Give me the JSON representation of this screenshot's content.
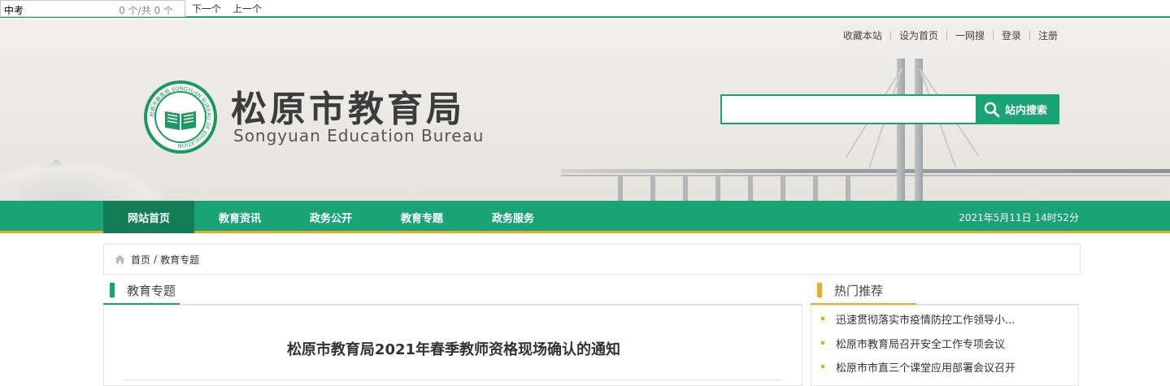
{
  "findbar": {
    "query": "中考",
    "count": "0 个/共 0 个",
    "next": "下一个",
    "prev": "上一个"
  },
  "header": {
    "toplinks": [
      "收藏本站",
      "设为首页",
      "一网搜",
      "登录",
      "注册"
    ],
    "title": "松原市教育局",
    "subtitle": "Songyuan Education Bureau",
    "logo_ring_text": "松原市教育局 SONGYUAN BUREAU OF EDUCATION",
    "search_value": "",
    "search_button": "站内搜索"
  },
  "nav": {
    "items": [
      "网站首页",
      "教育资讯",
      "政务公开",
      "教育专题",
      "政务服务"
    ],
    "active": 0,
    "datetime": "2021年5月11日 14时52分"
  },
  "breadcrumb": {
    "home": "首页",
    "separator": "/",
    "current": "教育专题"
  },
  "main": {
    "section_title": "教育专题",
    "article_title": "松原市教育局2021年春季教师资格现场确认的通知"
  },
  "sidebar": {
    "section_title": "热门推荐",
    "items": [
      "迅速贯彻落实市疫情防控工作领导小...",
      "松原市教育局召开安全工作专项会议",
      "松原市市直三个课堂应用部署会议召开"
    ]
  },
  "colors": {
    "brand_green": "#1aa475",
    "nav_active": "#137d58",
    "accent_orange": "#f5a623"
  }
}
